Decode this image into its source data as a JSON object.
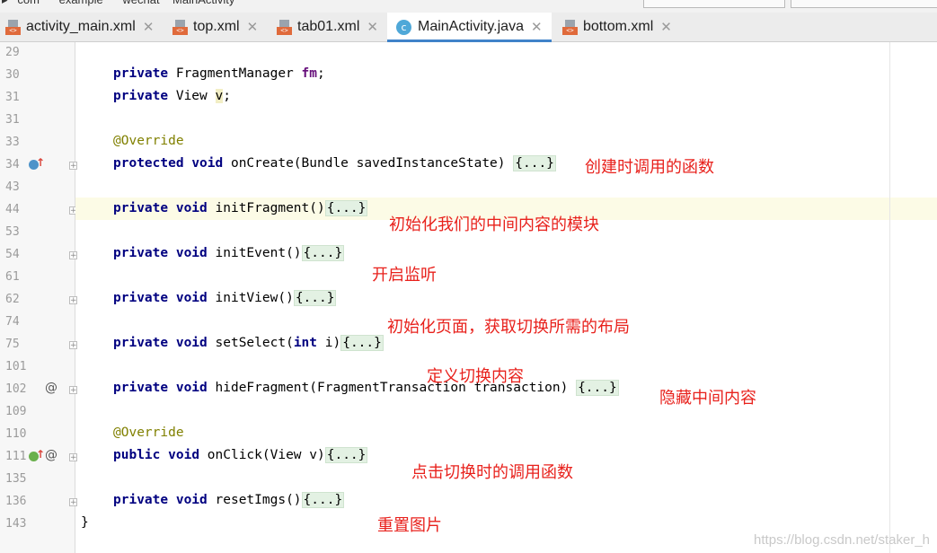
{
  "tabs": [
    {
      "label": "activity_main.xml",
      "kind": "xml",
      "active": false
    },
    {
      "label": "top.xml",
      "kind": "xml",
      "active": false
    },
    {
      "label": "tab01.xml",
      "kind": "xml",
      "active": false
    },
    {
      "label": "MainActivity.java",
      "kind": "java",
      "active": true
    },
    {
      "label": "bottom.xml",
      "kind": "xml",
      "active": false
    }
  ],
  "icons": {
    "xml": "xml-file-icon",
    "java": "java-class-icon",
    "close": "close-icon",
    "fold": "fold-expand-icon"
  },
  "colors": {
    "keyword": "#000080",
    "annotation": "#808000",
    "field": "#660e7a",
    "note": "#e8211c",
    "active_tab_underline": "#4083c9"
  },
  "lines": [
    {
      "num": "29",
      "code": ""
    },
    {
      "num": "30",
      "code": "private FragmentManager fm;"
    },
    {
      "num": "31",
      "code": "private View v;"
    },
    {
      "num": "31",
      "code": ""
    },
    {
      "num": "33",
      "code": "@Override"
    },
    {
      "num": "34",
      "code": "protected void onCreate(Bundle savedInstanceState) {...}"
    },
    {
      "num": "43",
      "code": ""
    },
    {
      "num": "44",
      "code": "private void initFragment(){...}"
    },
    {
      "num": "53",
      "code": ""
    },
    {
      "num": "54",
      "code": "private void initEvent(){...}"
    },
    {
      "num": "61",
      "code": ""
    },
    {
      "num": "62",
      "code": "private void initView(){...}"
    },
    {
      "num": "74",
      "code": ""
    },
    {
      "num": "75",
      "code": "private void setSelect(int i){...}"
    },
    {
      "num": "101",
      "code": ""
    },
    {
      "num": "102",
      "code": "private void hideFragment(FragmentTransaction transaction) {...}"
    },
    {
      "num": "109",
      "code": ""
    },
    {
      "num": "110",
      "code": "@Override"
    },
    {
      "num": "111",
      "code": "public void onClick(View v){...}"
    },
    {
      "num": "135",
      "code": ""
    },
    {
      "num": "136",
      "code": "private void resetImgs(){...}"
    },
    {
      "num": "143",
      "code": "}"
    }
  ],
  "code": {
    "kw_private": "private",
    "kw_protected": "protected",
    "kw_public": "public",
    "kw_void": "void",
    "kw_int": "int",
    "ann_override": "@Override",
    "type_fm": "FragmentManager",
    "fld_fm": "fm",
    "type_view": "View",
    "fld_v": "v",
    "semi": ";",
    "fold": "{...}",
    "oncreate": "onCreate(Bundle savedInstanceState) ",
    "initfragment": "initFragment()",
    "initevent": "initEvent()",
    "initview": "initView()",
    "setselect_a": "setSelect(",
    "setselect_b": " i)",
    "hidefragment": "hideFragment(FragmentTransaction transaction) ",
    "onclick": "onClick(View v)",
    "resetimgs": "resetImgs()",
    "close_brace": "}"
  },
  "notes": {
    "oncreate": "创建时调用的函数",
    "initfragment": "初始化我们的中间内容的模块",
    "initevent": "开启监听",
    "initview": "初始化页面，获取切换所需的布局",
    "setselect": "定义切换内容",
    "hidefragment": "隐藏中间内容",
    "onclick": "点击切换时的调用函数",
    "resetimgs": "重置图片"
  },
  "watermark": "https://blog.csdn.net/staker_h"
}
